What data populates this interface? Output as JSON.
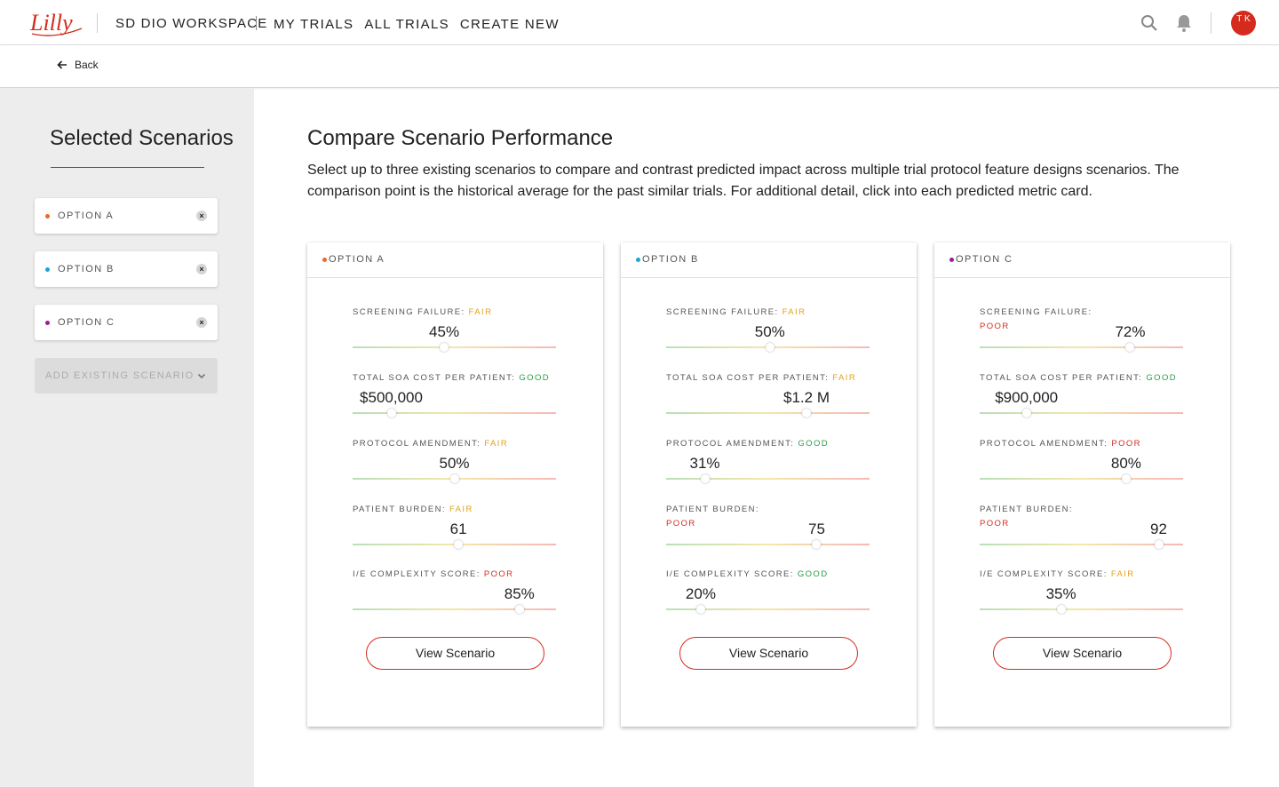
{
  "header": {
    "logo_text": "Lilly",
    "workspace": "SD DIO WORKSPACE",
    "nav": [
      "MY TRIALS",
      "ALL TRIALS",
      "CREATE NEW"
    ],
    "avatar_initials": "T K"
  },
  "subbar": {
    "back_label": "Back"
  },
  "sidebar": {
    "title": "Selected Scenarios",
    "chips": [
      {
        "label": "OPTION A",
        "color": "#f26522"
      },
      {
        "label": "OPTION B",
        "color": "#1aa3d8"
      },
      {
        "label": "OPTION C",
        "color": "#9c1a9c"
      }
    ],
    "add_existing": "ADD EXISTING SCENARIO"
  },
  "main": {
    "title": "Compare Scenario Performance",
    "description": "Select up to three existing scenarios to compare and contrast predicted impact across multiple trial protocol feature designs scenarios. The comparison point is the historical average for the past similar trials. For additional detail, click into each predicted metric card.",
    "view_button_label": "View Scenario"
  },
  "colors": {
    "good": "#2a9d4a",
    "fair": "#e0a21b",
    "poor": "#d52b1e",
    "accent": "#d52b1e"
  },
  "cards": [
    {
      "name": "OPTION A",
      "color": "#f26522",
      "metrics": [
        {
          "label": "SCREENING FAILURE:",
          "rating": "FAIR",
          "value": "45%",
          "position": 0.45
        },
        {
          "label": "TOTAL SOA COST PER PATIENT:",
          "rating": "GOOD",
          "value": "$500,000",
          "position": 0.19
        },
        {
          "label": "PROTOCOL AMENDMENT:",
          "rating": "FAIR",
          "value": "50%",
          "position": 0.5
        },
        {
          "label": "PATIENT BURDEN:",
          "rating": "FAIR",
          "value": "61",
          "position": 0.52
        },
        {
          "label": "I/E COMPLEXITY SCORE:",
          "rating": "POOR",
          "value": "85%",
          "position": 0.82
        }
      ]
    },
    {
      "name": "OPTION B",
      "color": "#1aa3d8",
      "metrics": [
        {
          "label": "SCREENING FAILURE:",
          "rating": "FAIR",
          "value": "50%",
          "position": 0.51
        },
        {
          "label": "TOTAL SOA COST PER PATIENT:",
          "rating": "FAIR",
          "value": "$1.2 M",
          "position": 0.69
        },
        {
          "label": "PROTOCOL AMENDMENT:",
          "rating": "GOOD",
          "value": "31%",
          "position": 0.19
        },
        {
          "label": "PATIENT BURDEN:",
          "rating": "POOR",
          "value": "75",
          "position": 0.74
        },
        {
          "label": "I/E COMPLEXITY SCORE:",
          "rating": "GOOD",
          "value": "20%",
          "position": 0.17
        }
      ]
    },
    {
      "name": "OPTION C",
      "color": "#9c1a9c",
      "metrics": [
        {
          "label": "SCREENING FAILURE:",
          "rating": "POOR",
          "value": "72%",
          "position": 0.74
        },
        {
          "label": "TOTAL SOA COST PER PATIENT:",
          "rating": "GOOD",
          "value": "$900,000",
          "position": 0.23
        },
        {
          "label": "PROTOCOL AMENDMENT:",
          "rating": "POOR",
          "value": "80%",
          "position": 0.72
        },
        {
          "label": "PATIENT BURDEN:",
          "rating": "POOR",
          "value": "92",
          "position": 0.88
        },
        {
          "label": "I/E COMPLEXITY SCORE:",
          "rating": "FAIR",
          "value": "35%",
          "position": 0.4
        }
      ]
    }
  ]
}
